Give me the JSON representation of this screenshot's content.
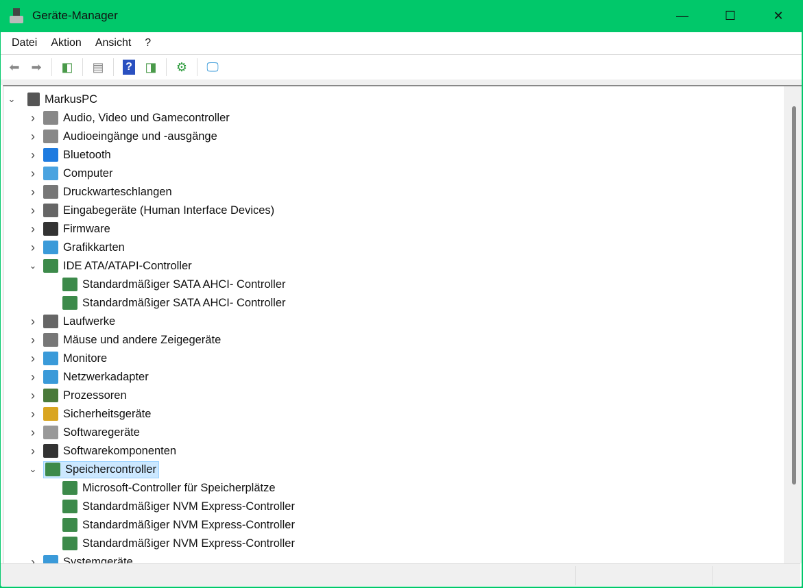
{
  "window": {
    "title": "Geräte-Manager",
    "minimize": "—",
    "maximize": "☐",
    "close": "✕"
  },
  "menu": [
    "Datei",
    "Aktion",
    "Ansicht",
    "?"
  ],
  "toolbar": [
    "back-icon",
    "forward-icon",
    "show-hide-console-tree-icon",
    "properties-icon",
    "help-icon",
    "action-pane-icon",
    "update-driver-icon",
    "scan-hardware-icon"
  ],
  "tree": {
    "root": "MarkusPC",
    "items": [
      {
        "label": "Audio, Video und Gamecontroller",
        "level": 1,
        "expanded": false,
        "color": "#888"
      },
      {
        "label": "Audioeingänge und -ausgänge",
        "level": 1,
        "expanded": false,
        "color": "#888"
      },
      {
        "label": "Bluetooth",
        "level": 1,
        "expanded": false,
        "color": "#1e7be0"
      },
      {
        "label": "Computer",
        "level": 1,
        "expanded": false,
        "color": "#4aa3e0"
      },
      {
        "label": "Druckwarteschlangen",
        "level": 1,
        "expanded": false,
        "color": "#777"
      },
      {
        "label": "Eingabegeräte (Human Interface Devices)",
        "level": 1,
        "expanded": false,
        "color": "#666"
      },
      {
        "label": "Firmware",
        "level": 1,
        "expanded": false,
        "color": "#333"
      },
      {
        "label": "Grafikkarten",
        "level": 1,
        "expanded": false,
        "color": "#3a9ad9"
      },
      {
        "label": "IDE ATA/ATAPI-Controller",
        "level": 1,
        "expanded": true,
        "color": "#3c8a4a"
      },
      {
        "label": "Standardmäßiger SATA AHCI- Controller",
        "level": 2,
        "color": "#3c8a4a"
      },
      {
        "label": "Standardmäßiger SATA AHCI- Controller",
        "level": 2,
        "color": "#3c8a4a"
      },
      {
        "label": "Laufwerke",
        "level": 1,
        "expanded": false,
        "color": "#666"
      },
      {
        "label": "Mäuse und andere Zeigegeräte",
        "level": 1,
        "expanded": false,
        "color": "#777"
      },
      {
        "label": "Monitore",
        "level": 1,
        "expanded": false,
        "color": "#3a9ad9"
      },
      {
        "label": "Netzwerkadapter",
        "level": 1,
        "expanded": false,
        "color": "#3a9ad9"
      },
      {
        "label": "Prozessoren",
        "level": 1,
        "expanded": false,
        "color": "#4a7a3a"
      },
      {
        "label": "Sicherheitsgeräte",
        "level": 1,
        "expanded": false,
        "color": "#d9a520"
      },
      {
        "label": "Softwaregeräte",
        "level": 1,
        "expanded": false,
        "color": "#999"
      },
      {
        "label": "Softwarekomponenten",
        "level": 1,
        "expanded": false,
        "color": "#333"
      },
      {
        "label": "Speichercontroller",
        "level": 1,
        "expanded": true,
        "selected": true,
        "color": "#3c8a4a"
      },
      {
        "label": "Microsoft-Controller für Speicherplätze",
        "level": 2,
        "color": "#3c8a4a"
      },
      {
        "label": "Standardmäßiger NVM Express-Controller",
        "level": 2,
        "color": "#3c8a4a"
      },
      {
        "label": "Standardmäßiger NVM Express-Controller",
        "level": 2,
        "color": "#3c8a4a"
      },
      {
        "label": "Standardmäßiger NVM Express-Controller",
        "level": 2,
        "color": "#3c8a4a"
      },
      {
        "label": "Systemgeräte",
        "level": 1,
        "expanded": false,
        "color": "#3a9ad9"
      }
    ]
  }
}
